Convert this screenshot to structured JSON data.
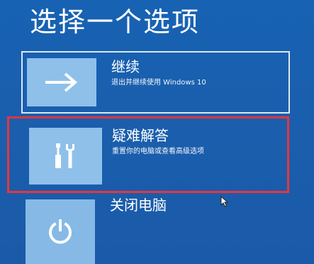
{
  "page": {
    "title": "选择一个选项"
  },
  "options": [
    {
      "label": "继续",
      "description": "退出并继续使用 Windows 10",
      "icon": "arrow-right-icon"
    },
    {
      "label": "疑难解答",
      "description": "重置你的电脑或查看高级选项",
      "icon": "screwdriver-wrench-icon",
      "highlighted": true
    },
    {
      "label": "关闭电脑",
      "icon": "power-icon"
    }
  ],
  "colors": {
    "background": "#1a5fae",
    "tile": "#8ec0ea",
    "highlight_border": "#e8353a"
  },
  "icons": {
    "cursor": "mouse-pointer-icon"
  }
}
